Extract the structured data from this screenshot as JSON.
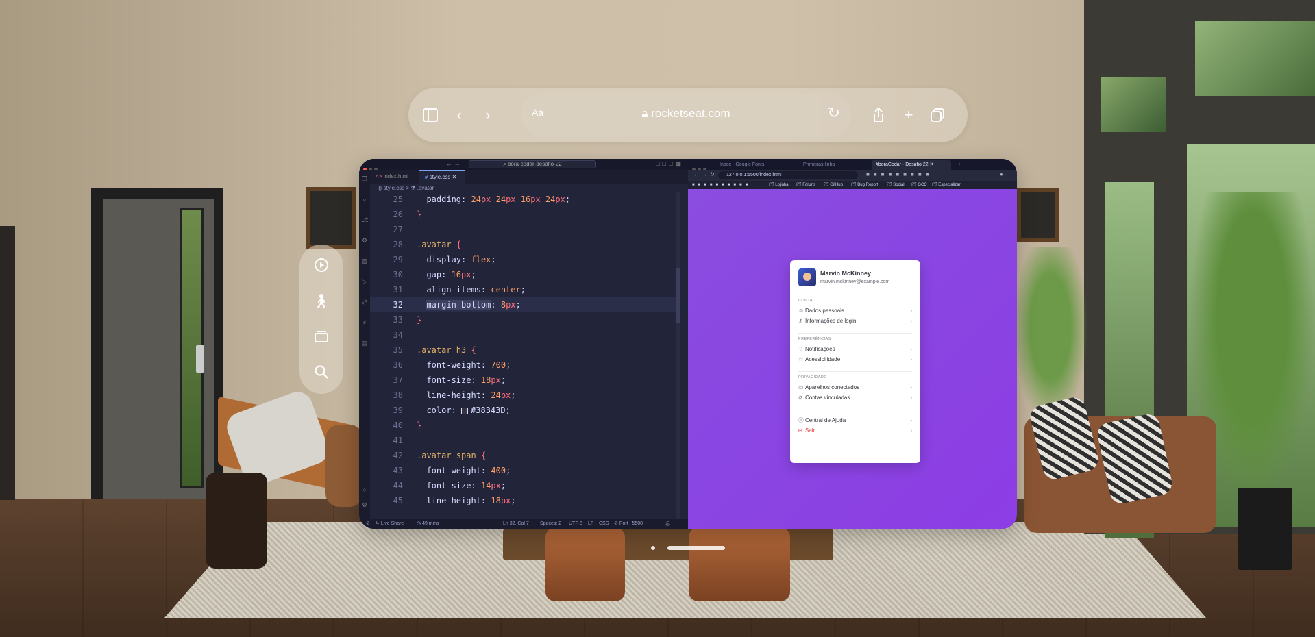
{
  "safari": {
    "aa_label": "Aa",
    "url": "rocketseat.com",
    "icons": [
      "sidebar-icon",
      "back-icon",
      "forward-icon",
      "lock-icon",
      "reload-icon",
      "share-icon",
      "plus-icon",
      "tabs-icon"
    ]
  },
  "ornament": {
    "icons": [
      "play-icon",
      "accessibility-icon",
      "stack-icon",
      "search-icon"
    ]
  },
  "vscode": {
    "search": "bora-codar-desafio-22",
    "tabs": [
      {
        "label": "index.html",
        "active": false
      },
      {
        "label": "style.css",
        "active": true
      }
    ],
    "breadcrumb": "{} style.css > ⚗ .avatar",
    "lines": [
      {
        "n": "25",
        "text": "  padding: 24px 24px 16px 24px;"
      },
      {
        "n": "26",
        "text": "}"
      },
      {
        "n": "27",
        "text": ""
      },
      {
        "n": "28",
        "text": ".avatar {"
      },
      {
        "n": "29",
        "text": "  display: flex;"
      },
      {
        "n": "30",
        "text": "  gap: 16px;"
      },
      {
        "n": "31",
        "text": "  align-items: center;"
      },
      {
        "n": "32",
        "text": "  margin-bottom: 8px;"
      },
      {
        "n": "33",
        "text": "}"
      },
      {
        "n": "34",
        "text": ""
      },
      {
        "n": "35",
        "text": ".avatar h3 {"
      },
      {
        "n": "36",
        "text": "  font-weight: 700;"
      },
      {
        "n": "37",
        "text": "  font-size: 18px;"
      },
      {
        "n": "38",
        "text": "  line-height: 24px;"
      },
      {
        "n": "39",
        "text": "  color: #38343D;"
      },
      {
        "n": "40",
        "text": "}"
      },
      {
        "n": "41",
        "text": ""
      },
      {
        "n": "42",
        "text": ".avatar span {"
      },
      {
        "n": "43",
        "text": "  font-weight: 400;"
      },
      {
        "n": "44",
        "text": "  font-size: 14px;"
      },
      {
        "n": "45",
        "text": "  line-height: 18px;"
      }
    ],
    "current_line": "32",
    "status": {
      "live_share": "Live Share",
      "mins": "49 mins",
      "cursor": "Ln 32, Col 7",
      "spaces": "Spaces: 2",
      "encoding": "UTF-8",
      "eol": "LF",
      "lang": "CSS",
      "port": "Port : 5500"
    }
  },
  "browser": {
    "tabs": [
      {
        "label": "Inbox - Google Fonts",
        "active": false
      },
      {
        "label": "Primeiras linha",
        "active": false
      },
      {
        "label": "#boraCodar - Desafio 22",
        "active": true
      }
    ],
    "address": "127.0.0.1:5500/index.html",
    "bookmarks": [
      "Lojinha",
      "Fóruns",
      "GitHub",
      "Bug Report",
      "Social",
      "GCC",
      "Especializar"
    ]
  },
  "card": {
    "name": "Marvin McKinney",
    "email": "marvin.mckinney@example.com",
    "sections": [
      {
        "title": "CONTA",
        "items": [
          {
            "label": "Dados pessoais",
            "icon": "user-icon"
          },
          {
            "label": "Informações de login",
            "icon": "key-icon"
          }
        ]
      },
      {
        "title": "PREFERÊNCIAS",
        "items": [
          {
            "label": "Notificações",
            "icon": "bell-icon"
          },
          {
            "label": "Acessibilidade",
            "icon": "star-icon"
          }
        ]
      },
      {
        "title": "PRIVACIDADE",
        "items": [
          {
            "label": "Aparelhos conectados",
            "icon": "devices-icon"
          },
          {
            "label": "Contas vinculadas",
            "icon": "link-icon"
          }
        ]
      },
      {
        "title": "",
        "items": [
          {
            "label": "Central de Ajuda",
            "icon": "help-icon"
          },
          {
            "label": "Sair",
            "icon": "logout-icon",
            "danger": true
          }
        ]
      }
    ]
  }
}
